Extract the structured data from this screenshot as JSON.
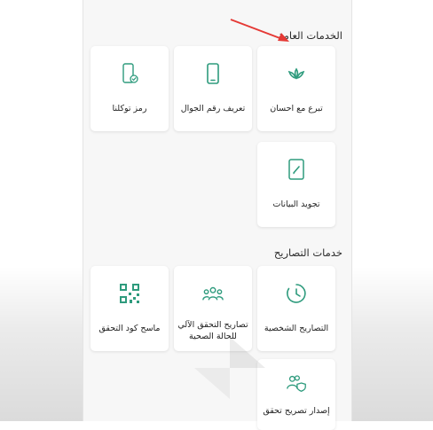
{
  "sections": {
    "general": {
      "title": "الخدمات العامة"
    },
    "permits": {
      "title": "خدمات التصاريح"
    }
  },
  "cards": {
    "donate": {
      "label": "تبرع مع احسان",
      "icon": "ehsan-leaf-icon"
    },
    "phone_id": {
      "label": "تعريف رقم الجوال",
      "icon": "mobile-phone-icon"
    },
    "tawakkalna_code": {
      "label": "رمز توكلنا",
      "icon": "phone-check-icon"
    },
    "data_quality": {
      "label": "تجويد البيانات",
      "icon": "edit-document-icon"
    },
    "personal_permits": {
      "label": "التصاريح الشخصية",
      "icon": "clock-icon"
    },
    "health_status_permits": {
      "label": "تصاريح التحقق الآلي للحالة الصحية",
      "icon": "people-group-icon"
    },
    "qr_scanner": {
      "label": "ماسح كود التحقق",
      "icon": "qr-code-icon"
    },
    "issue_verification": {
      "label": "إصدار تصريح تحقق",
      "icon": "users-shield-icon"
    }
  },
  "colors": {
    "accent": "#2e9b7d",
    "arrow": "#e53935"
  }
}
